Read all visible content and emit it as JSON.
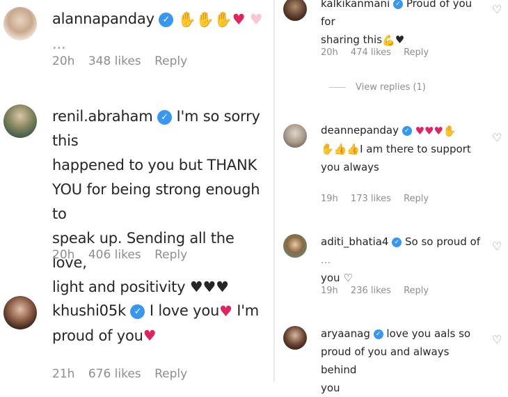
{
  "left": {
    "comments": [
      {
        "username": "alannapanday",
        "text": "",
        "emojis": [
          "clap",
          "clap",
          "clap",
          "red-heart",
          "pink-heart"
        ],
        "trailing": "...",
        "time": "20h",
        "likes": "348 likes",
        "reply": "Reply"
      },
      {
        "username": "renil.abraham",
        "lines": [
          "I'm so sorry this",
          "happened to you but THANK",
          "YOU for being strong enough to",
          "speak up. Sending all the love,",
          "light and positivity ♥♥♥"
        ],
        "time": "20h",
        "likes": "406 likes",
        "reply": "Reply"
      },
      {
        "username": "khushi05k",
        "line1": "I love you",
        "line1_after": "I'm",
        "line2": "proud of you",
        "time": "21h",
        "likes": "676 likes",
        "reply": "Reply"
      }
    ]
  },
  "right": {
    "comments": [
      {
        "username": "kalkikanmani",
        "line1": "Proud of you for",
        "line2": "sharing this",
        "line2_suffix": "♥",
        "time": "20h",
        "likes": "474 likes",
        "reply": "Reply",
        "view_replies": "View replies (1)"
      },
      {
        "username": "deannepanday",
        "line2": "I am there to support",
        "line3": "you always",
        "time": "19h",
        "likes": "173 likes",
        "reply": "Reply"
      },
      {
        "username": "aditi_bhatia4",
        "line1": "So so proud of",
        "trailing": "...",
        "line2": "you",
        "time": "19h",
        "likes": "236 likes",
        "reply": "Reply"
      },
      {
        "username": "aryaanag",
        "line1": "love you aals so",
        "line2": "proud of you and always behind",
        "line3": "you"
      }
    ]
  },
  "colors": {
    "verified": "#3897f0",
    "meta": "#8e8e8e",
    "heart": "#e0245e"
  }
}
